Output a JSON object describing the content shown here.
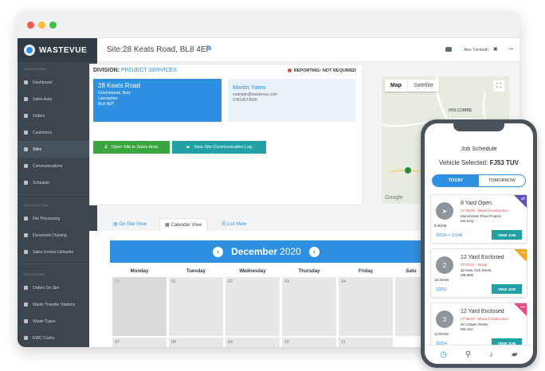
{
  "app": {
    "logo_text": "WASTEVUE"
  },
  "sidebar": {
    "sections": [
      {
        "label": "NAVIGATION",
        "items": [
          "Dashboard",
          "Sales Area",
          "Orders",
          "Customers",
          "Sites",
          "Communications",
          "Schedule"
        ],
        "active": "Sites"
      },
      {
        "label": "ACCOUNTING",
        "items": [
          "File Processing",
          "Document Chasing",
          "Sales Invoice Uploader"
        ]
      },
      {
        "label": "REPORTING",
        "items": [
          "Orders On Site",
          "Waste Transfer Stations",
          "Waste Types",
          "EWC Codes"
        ]
      }
    ]
  },
  "header": {
    "site_title": "Site:28 Keats Road, BL8 4EP",
    "user_name": "Alex Trenbath"
  },
  "site_card": {
    "division_label": "DIVISION:",
    "division_value": "PROJECT SERVICES",
    "reporting": "REPORTING: NOT REQUIRED",
    "address": {
      "line1": "28 Keats Road",
      "line2": "Greenmount, Bury",
      "line3": "Lancashire",
      "line4": "BL8 4EP"
    },
    "contact": {
      "name": "Martin Yates",
      "email": "example@wastevue.com",
      "phone": "07814573559"
    },
    "open_sales_label": "Open Site in Sales Area",
    "comm_log_label": "View Site Communication Log"
  },
  "map": {
    "tab_map": "Map",
    "tab_satellite": "Satellite",
    "attribution": "Google",
    "label": "HOLCOMBE"
  },
  "view_tabs": {
    "on_site": "On Site View",
    "calendar": "Calendar View",
    "list": "List View"
  },
  "calendar": {
    "month": "December",
    "year": "2020",
    "days_of_week": [
      "Monday",
      "Tuesday",
      "Wednesday",
      "Thursday",
      "Friday",
      "Satu"
    ],
    "week1": [
      "30",
      "01",
      "02",
      "03",
      "04",
      ""
    ],
    "week2": [
      "07",
      "08",
      "09",
      "10",
      "11",
      ""
    ]
  },
  "phone": {
    "title": "Job Schedule",
    "vehicle_label": "Vehicle Selected:",
    "vehicle_reg": "FJ53 TUV",
    "tab_today": "TODAY",
    "tab_tomorrow": "TOMORROW",
    "jobs": [
      {
        "title": "8 Yard Open",
        "waste": "17:39:04 - Mixed Construction",
        "addr1": "Manchester Flour Project,",
        "addr2": "M4 6AQ",
        "time": "9:30AM",
        "ref": "10334 > 10346",
        "button": "VIEW JOB",
        "corner_color": "#5b50b8",
        "number": ""
      },
      {
        "title": "12 Yard Enclosed",
        "waste": "17:02:01 - Wood",
        "addr1": "32 New York Street,",
        "addr2": "M5 5ED",
        "time": "10:30AM",
        "ref": "10352",
        "button": "VIEW JOB",
        "corner_color": "#f2a72b",
        "number": "2"
      },
      {
        "title": "12 Yard Enclosed",
        "waste": "17:39:04 - Mixed Construction",
        "addr1": "40 Chapel Street,",
        "addr2": "M4 2SA",
        "time": "11:00AM",
        "ref": "10354",
        "button": "VIEW JOB",
        "corner_color": "#e64b82",
        "number": "3"
      }
    ]
  }
}
